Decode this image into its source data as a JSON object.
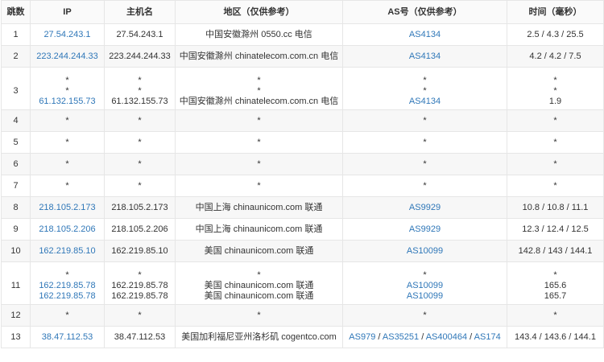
{
  "headers": [
    "跳数",
    "IP",
    "主机名",
    "地区（仅供参考）",
    "AS号（仅供参考）",
    "时间（毫秒）"
  ],
  "rows": [
    {
      "hop": "1",
      "ip": [
        "27.54.243.1"
      ],
      "host": [
        "27.54.243.1"
      ],
      "region": [
        "中国安徽滁州 0550.cc 电信"
      ],
      "as": [
        [
          "AS4134"
        ]
      ],
      "time": [
        "2.5 / 4.3 / 25.5"
      ]
    },
    {
      "hop": "2",
      "ip": [
        "223.244.244.33"
      ],
      "host": [
        "223.244.244.33"
      ],
      "region": [
        "中国安徽滁州 chinatelecom.com.cn 电信"
      ],
      "as": [
        [
          "AS4134"
        ]
      ],
      "time": [
        "4.2 / 4.2 / 7.5"
      ]
    },
    {
      "hop": "3",
      "ip": [
        "*",
        "*",
        "61.132.155.73"
      ],
      "host": [
        "*",
        "*",
        "61.132.155.73"
      ],
      "region": [
        "*",
        "*",
        "中国安徽滁州 chinatelecom.com.cn 电信"
      ],
      "as": [
        [
          "*"
        ],
        [
          "*"
        ],
        [
          "AS4134"
        ]
      ],
      "time": [
        "*",
        "*",
        "1.9"
      ]
    },
    {
      "hop": "4",
      "ip": [
        "*"
      ],
      "host": [
        "*"
      ],
      "region": [
        "*"
      ],
      "as": [
        [
          "*"
        ]
      ],
      "time": [
        "*"
      ]
    },
    {
      "hop": "5",
      "ip": [
        "*"
      ],
      "host": [
        "*"
      ],
      "region": [
        "*"
      ],
      "as": [
        [
          "*"
        ]
      ],
      "time": [
        "*"
      ]
    },
    {
      "hop": "6",
      "ip": [
        "*"
      ],
      "host": [
        "*"
      ],
      "region": [
        "*"
      ],
      "as": [
        [
          "*"
        ]
      ],
      "time": [
        "*"
      ]
    },
    {
      "hop": "7",
      "ip": [
        "*"
      ],
      "host": [
        "*"
      ],
      "region": [
        "*"
      ],
      "as": [
        [
          "*"
        ]
      ],
      "time": [
        "*"
      ]
    },
    {
      "hop": "8",
      "ip": [
        "218.105.2.173"
      ],
      "host": [
        "218.105.2.173"
      ],
      "region": [
        "中国上海 chinaunicom.com 联通"
      ],
      "as": [
        [
          "AS9929"
        ]
      ],
      "time": [
        "10.8 / 10.8 / 11.1"
      ]
    },
    {
      "hop": "9",
      "ip": [
        "218.105.2.206"
      ],
      "host": [
        "218.105.2.206"
      ],
      "region": [
        "中国上海 chinaunicom.com 联通"
      ],
      "as": [
        [
          "AS9929"
        ]
      ],
      "time": [
        "12.3 / 12.4 / 12.5"
      ]
    },
    {
      "hop": "10",
      "ip": [
        "162.219.85.10"
      ],
      "host": [
        "162.219.85.10"
      ],
      "region": [
        "美国 chinaunicom.com 联通"
      ],
      "as": [
        [
          "AS10099"
        ]
      ],
      "time": [
        "142.8 / 143 / 144.1"
      ]
    },
    {
      "hop": "11",
      "ip": [
        "*",
        "162.219.85.78",
        "162.219.85.78"
      ],
      "host": [
        "*",
        "162.219.85.78",
        "162.219.85.78"
      ],
      "region": [
        "*",
        "美国 chinaunicom.com 联通",
        "美国 chinaunicom.com 联通"
      ],
      "as": [
        [
          "*"
        ],
        [
          "AS10099"
        ],
        [
          "AS10099"
        ]
      ],
      "time": [
        "*",
        "165.6",
        "165.7"
      ]
    },
    {
      "hop": "12",
      "ip": [
        "*"
      ],
      "host": [
        "*"
      ],
      "region": [
        "*"
      ],
      "as": [
        [
          "*"
        ]
      ],
      "time": [
        "*"
      ]
    },
    {
      "hop": "13",
      "ip": [
        "38.47.112.53"
      ],
      "host": [
        "38.47.112.53"
      ],
      "region": [
        "美国加利福尼亚州洛杉矶 cogentco.com"
      ],
      "as": [
        [
          "AS979",
          "AS35251",
          "AS400464",
          "AS174"
        ]
      ],
      "time": [
        "143.4 / 143.6 / 144.1"
      ]
    }
  ],
  "as_separator": " / ",
  "colors": {
    "link": "#2f77b8",
    "text": "#333333",
    "border": "#e6e6e6",
    "stripe": "#f7f7f7"
  }
}
